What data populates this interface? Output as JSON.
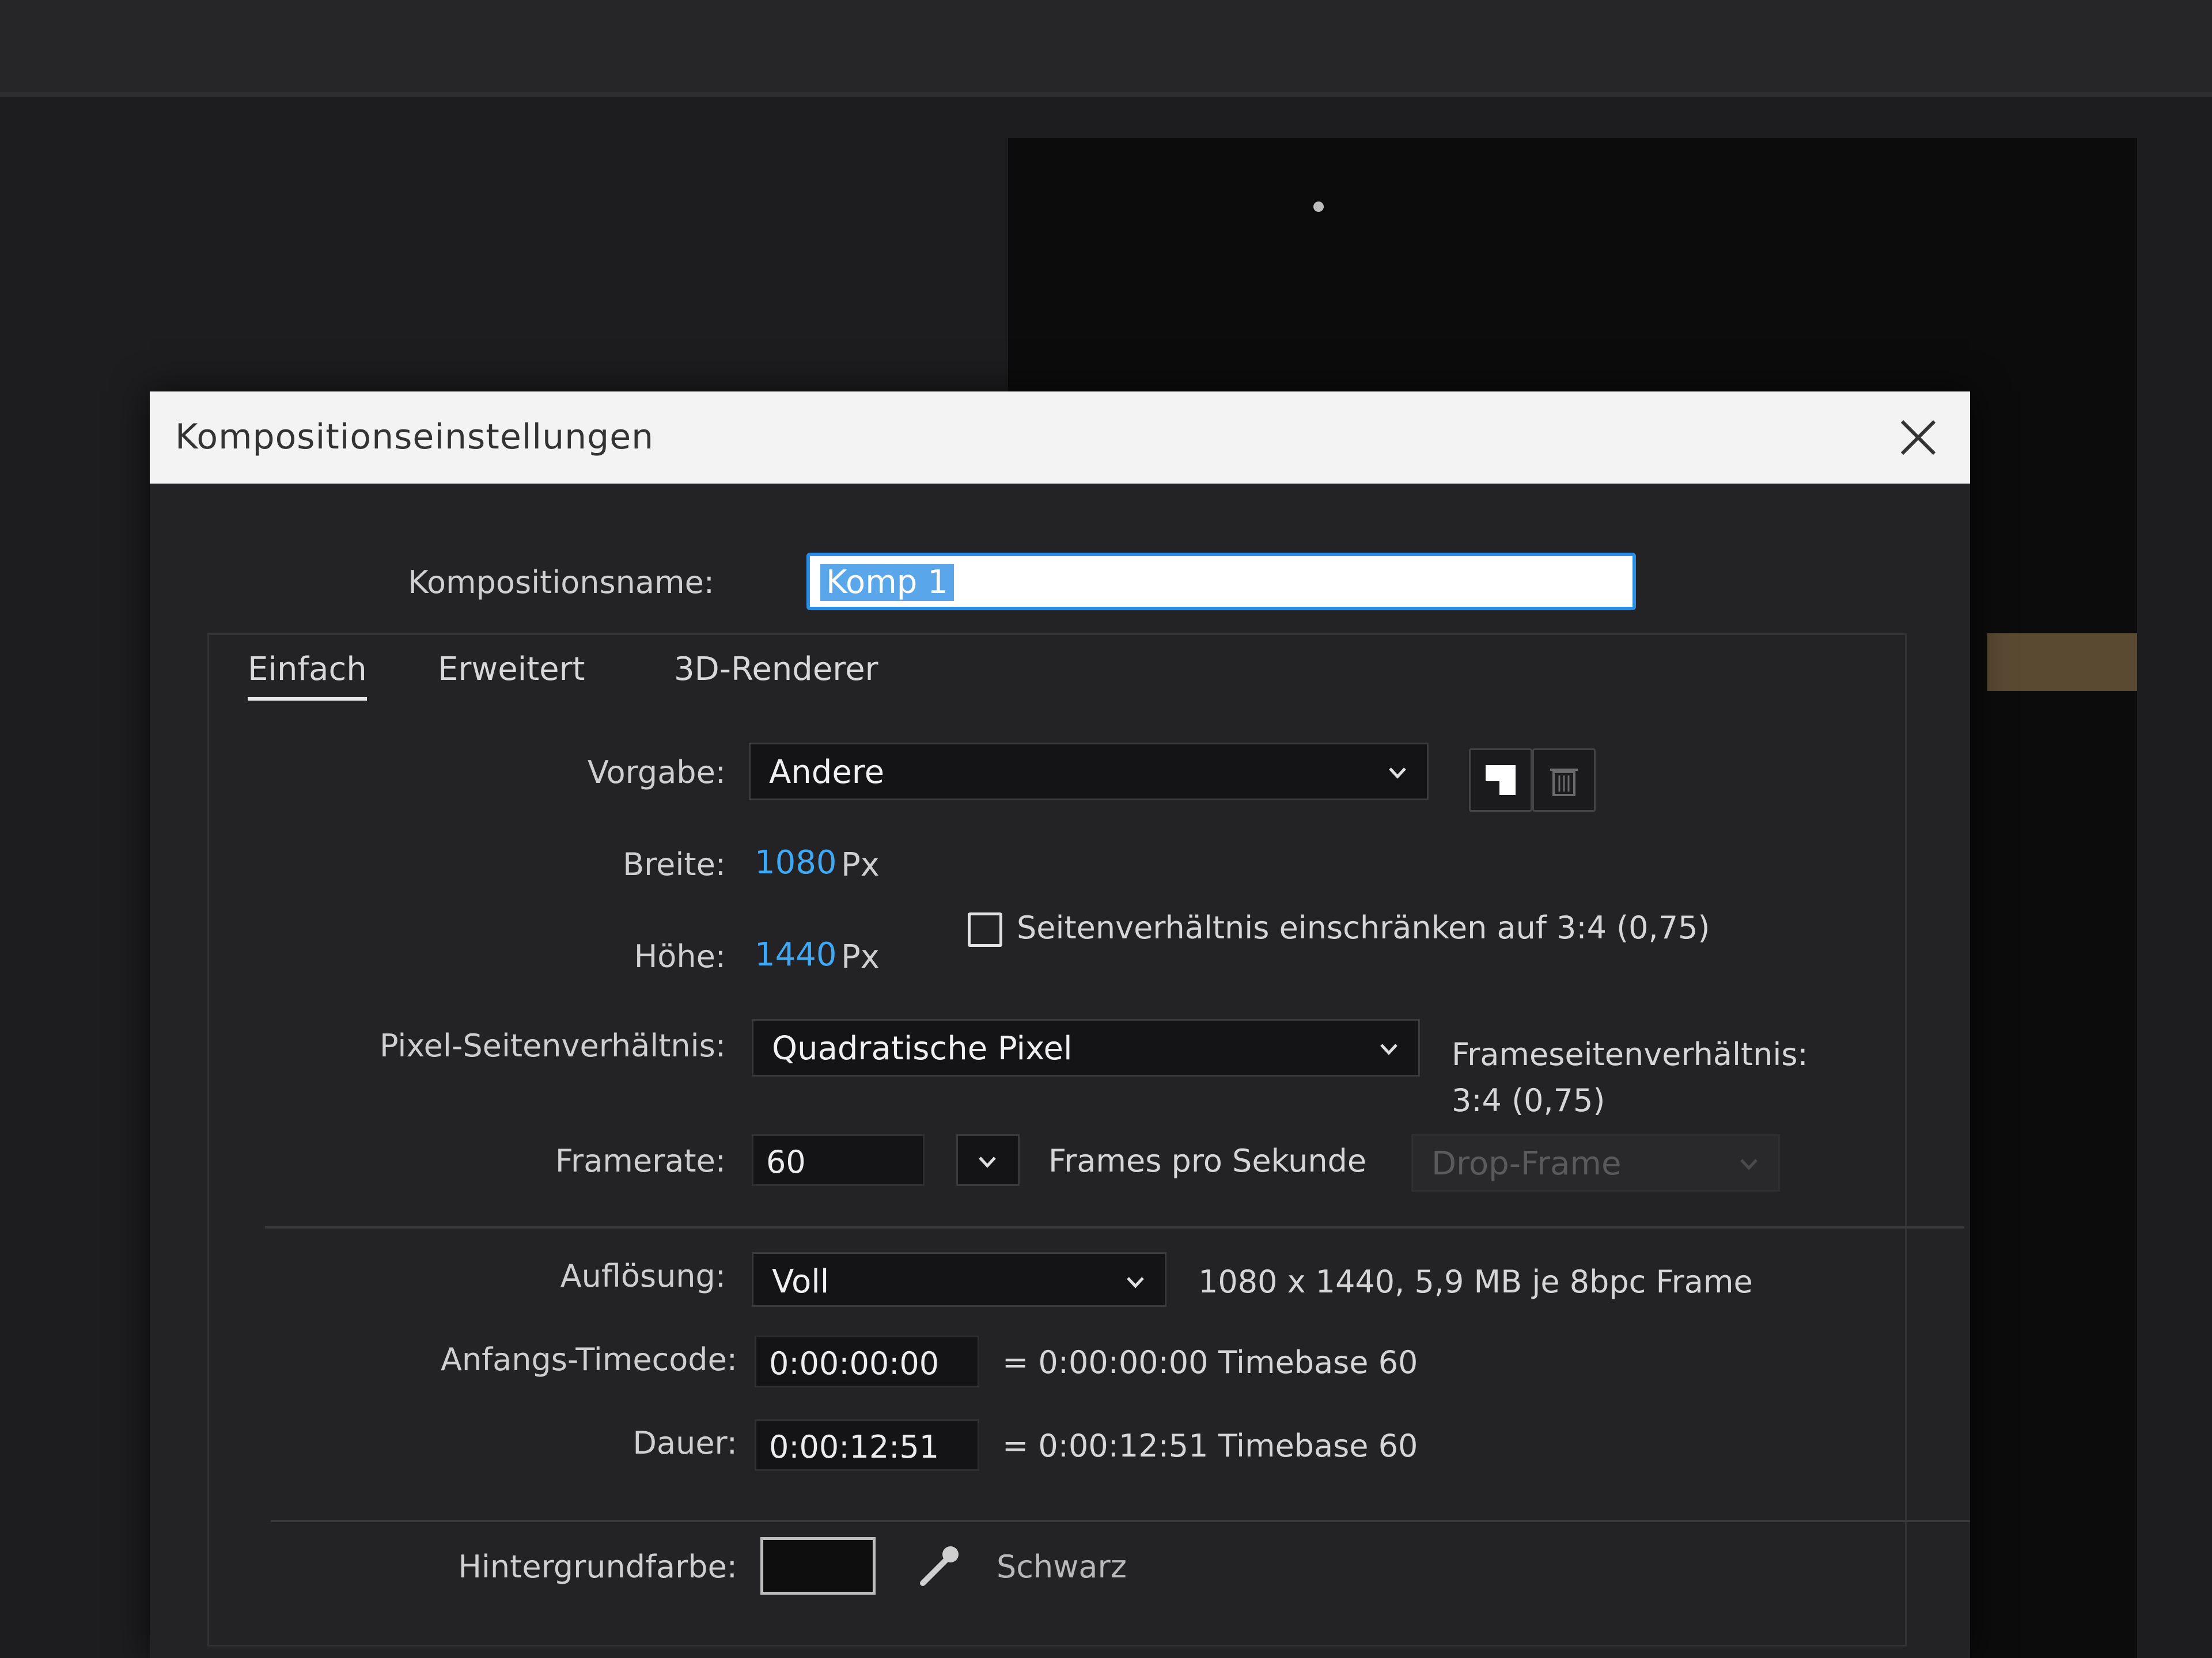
{
  "dialog": {
    "title": "Kompositionseinstellungen",
    "close_glyph": "×"
  },
  "comp_name": {
    "label": "Kompositionsname:",
    "value": "Komp 1"
  },
  "tabs": [
    {
      "label": "Einfach",
      "active": true
    },
    {
      "label": "Erweitert",
      "active": false
    },
    {
      "label": "3D-Renderer",
      "active": false
    }
  ],
  "preset": {
    "label": "Vorgabe:",
    "value": "Andere",
    "icons": [
      "save-preset-icon",
      "delete-preset-icon"
    ]
  },
  "width": {
    "label": "Breite:",
    "value": "1080",
    "unit": "Px"
  },
  "height": {
    "label": "Höhe:",
    "value": "1440",
    "unit": "Px"
  },
  "lock_aspect": {
    "label": "Seitenverhältnis einschränken auf 3:4 (0,75)",
    "checked": false
  },
  "pixel_aspect": {
    "label": "Pixel-Seitenverhältnis:",
    "value": "Quadratische Pixel",
    "frame_aspect_label": "Frameseitenverhältnis:",
    "frame_aspect_value": "3:4 (0,75)"
  },
  "framerate": {
    "label": "Framerate:",
    "value": "60",
    "unit": "Frames pro Sekunde",
    "drop_frame": "Drop-Frame"
  },
  "resolution": {
    "label": "Auflösung:",
    "value": "Voll",
    "info": "1080 x 1440, 5,9 MB je 8bpc Frame"
  },
  "start_timecode": {
    "label": "Anfangs-Timecode:",
    "value": "0:00:00:00",
    "info": "= 0:00:00:00  Timebase 60"
  },
  "duration": {
    "label": "Dauer:",
    "value": "0:00:12:51",
    "info": "= 0:00:12:51  Timebase 60"
  },
  "background": {
    "label": "Hintergrundfarbe:",
    "color_name": "Schwarz",
    "color": "#000000"
  },
  "colors": {
    "accent": "#3fa9f5",
    "selection": "#5aa6ea",
    "dialog_bg": "#232325"
  }
}
